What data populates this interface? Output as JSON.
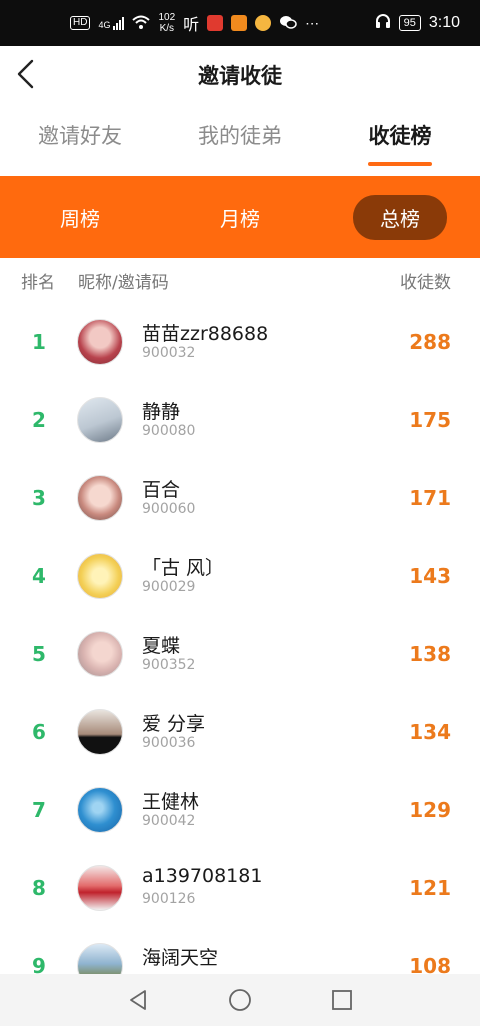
{
  "status_bar": {
    "network_chip": "HD",
    "signal_label": "4G",
    "speed_value": "102",
    "speed_unit": "K/s",
    "music_label": "听",
    "battery": "95",
    "time": "3:10"
  },
  "header": {
    "title": "邀请收徒"
  },
  "tabs": [
    {
      "label": "邀请好友",
      "active": false
    },
    {
      "label": "我的徒弟",
      "active": false
    },
    {
      "label": "收徒榜",
      "active": true
    }
  ],
  "ranges": [
    {
      "label": "周榜",
      "active": false
    },
    {
      "label": "月榜",
      "active": false
    },
    {
      "label": "总榜",
      "active": true
    }
  ],
  "columns": {
    "rank": "排名",
    "name": "昵称/邀请码",
    "count": "收徒数"
  },
  "rows": [
    {
      "rank": "1",
      "name": "苗苗zzr88688",
      "code": "900032",
      "count": "288"
    },
    {
      "rank": "2",
      "name": "静静",
      "code": "900080",
      "count": "175"
    },
    {
      "rank": "3",
      "name": "百合",
      "code": "900060",
      "count": "171"
    },
    {
      "rank": "4",
      "name": "「古 风〕",
      "code": "900029",
      "count": "143"
    },
    {
      "rank": "5",
      "name": "夏蝶",
      "code": "900352",
      "count": "138"
    },
    {
      "rank": "6",
      "name": "爱 分享",
      "code": "900036",
      "count": "134"
    },
    {
      "rank": "7",
      "name": "王健林",
      "code": "900042",
      "count": "129"
    },
    {
      "rank": "8",
      "name": "a139708181",
      "code": "900126",
      "count": "121"
    },
    {
      "rank": "9",
      "name": "海阔天空",
      "code": "",
      "count": "108"
    }
  ],
  "colors": {
    "accent": "#ff6a0e",
    "active_pill": "#8a3a08",
    "rank_green": "#2eb86a",
    "count_orange": "#ec7a1c"
  },
  "icons": {
    "back": "back-arrow-icon",
    "nav_back": "triangle-back-icon",
    "nav_home": "circle-home-icon",
    "nav_recent": "square-recents-icon"
  }
}
